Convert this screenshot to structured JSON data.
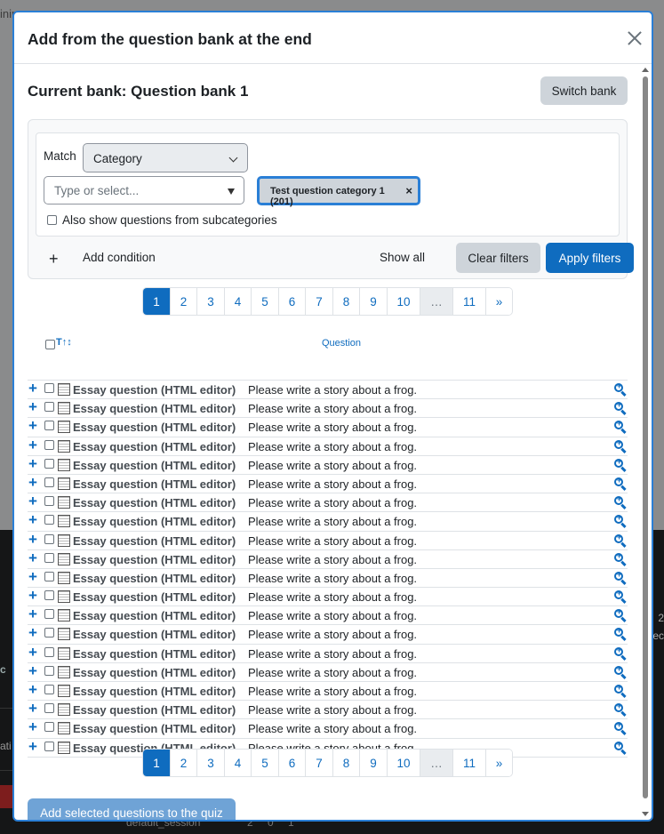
{
  "background": {
    "top_text": "inin",
    "left_c": "c",
    "left_at": "ati",
    "right_2": "2",
    "right_ec": "ec",
    "bottom_strip": "default_session",
    "bottom_nums": [
      "2",
      "0",
      "1"
    ]
  },
  "modal": {
    "title": "Add from the question bank at the end",
    "close_label": "×",
    "bank_title": "Current bank: Question bank 1",
    "switch_bank": "Switch bank"
  },
  "filters": {
    "match_label": "Match",
    "match_value": "Category",
    "type_placeholder": "Type or select...",
    "chip_label": "Test question category 1 (201)",
    "chip_remove": "×",
    "subcategories_label": "Also show questions from subcategories",
    "add_condition_icon": "+",
    "add_condition": "Add condition",
    "show_all": "Show all",
    "clear_filters": "Clear filters",
    "apply_filters": "Apply filters"
  },
  "pagination": {
    "pages": [
      "1",
      "2",
      "3",
      "4",
      "5",
      "6",
      "7",
      "8",
      "9",
      "10",
      "…",
      "11",
      "»"
    ],
    "active": "1"
  },
  "table": {
    "sort_icon": "T↑↕",
    "question_header": "Question",
    "rows": [
      {
        "name": "Essay question (HTML editor)",
        "text": "Please write a story about a frog."
      },
      {
        "name": "Essay question (HTML editor)",
        "text": "Please write a story about a frog."
      },
      {
        "name": "Essay question (HTML editor)",
        "text": "Please write a story about a frog."
      },
      {
        "name": "Essay question (HTML editor)",
        "text": "Please write a story about a frog."
      },
      {
        "name": "Essay question (HTML editor)",
        "text": "Please write a story about a frog."
      },
      {
        "name": "Essay question (HTML editor)",
        "text": "Please write a story about a frog."
      },
      {
        "name": "Essay question (HTML editor)",
        "text": "Please write a story about a frog."
      },
      {
        "name": "Essay question (HTML editor)",
        "text": "Please write a story about a frog."
      },
      {
        "name": "Essay question (HTML editor)",
        "text": "Please write a story about a frog."
      },
      {
        "name": "Essay question (HTML editor)",
        "text": "Please write a story about a frog."
      },
      {
        "name": "Essay question (HTML editor)",
        "text": "Please write a story about a frog."
      },
      {
        "name": "Essay question (HTML editor)",
        "text": "Please write a story about a frog."
      },
      {
        "name": "Essay question (HTML editor)",
        "text": "Please write a story about a frog."
      },
      {
        "name": "Essay question (HTML editor)",
        "text": "Please write a story about a frog."
      },
      {
        "name": "Essay question (HTML editor)",
        "text": "Please write a story about a frog."
      },
      {
        "name": "Essay question (HTML editor)",
        "text": "Please write a story about a frog."
      },
      {
        "name": "Essay question (HTML editor)",
        "text": "Please write a story about a frog."
      },
      {
        "name": "Essay question (HTML editor)",
        "text": "Please write a story about a frog."
      },
      {
        "name": "Essay question (HTML editor)",
        "text": "Please write a story about a frog."
      },
      {
        "name": "Essay question (HTML editor)",
        "text": "Please write a story about a frog."
      }
    ],
    "row_add_icon": "+",
    "row_type_icon": "essay-question-icon",
    "row_preview_icon": "zoom-in-icon"
  },
  "footer": {
    "add_selected": "Add selected questions to the quiz"
  },
  "colors": {
    "primary": "#0f6cbf",
    "focus_border": "#2a7fd6",
    "secondary_button": "#ced4da"
  }
}
